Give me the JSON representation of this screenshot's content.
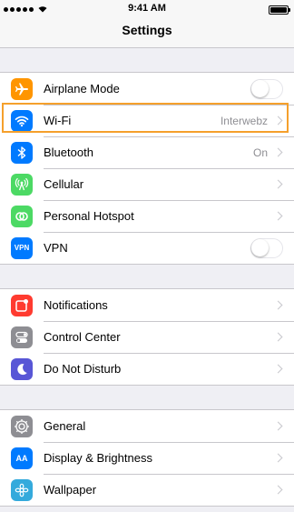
{
  "status_bar": {
    "time": "9:41 AM",
    "signal_icon": "signal-icon",
    "wifi_icon": "wifi-icon",
    "battery_icon": "battery-icon"
  },
  "nav": {
    "title": "Settings"
  },
  "groups": [
    {
      "items": [
        {
          "label": "Airplane Mode",
          "icon": "airplane-icon",
          "color": "#ff9500",
          "accessory": "toggle",
          "toggle_on": false
        },
        {
          "label": "Wi-Fi",
          "icon": "wifi-icon",
          "color": "#007aff",
          "accessory": "chevron",
          "value": "Interwebz",
          "highlighted": true
        },
        {
          "label": "Bluetooth",
          "icon": "bluetooth-icon",
          "color": "#007aff",
          "accessory": "chevron",
          "value": "On"
        },
        {
          "label": "Cellular",
          "icon": "cellular-icon",
          "color": "#4cd964",
          "accessory": "chevron"
        },
        {
          "label": "Personal Hotspot",
          "icon": "hotspot-icon",
          "color": "#4cd964",
          "accessory": "chevron"
        },
        {
          "label": "VPN",
          "icon": "vpn-icon",
          "icon_text": "VPN",
          "color": "#007aff",
          "accessory": "toggle",
          "toggle_on": false
        }
      ]
    },
    {
      "items": [
        {
          "label": "Notifications",
          "icon": "notifications-icon",
          "color": "#ff3b30",
          "accessory": "chevron"
        },
        {
          "label": "Control Center",
          "icon": "control-center-icon",
          "color": "#8e8e93",
          "accessory": "chevron"
        },
        {
          "label": "Do Not Disturb",
          "icon": "moon-icon",
          "color": "#5856d6",
          "accessory": "chevron"
        }
      ]
    },
    {
      "items": [
        {
          "label": "General",
          "icon": "gear-icon",
          "color": "#8e8e93",
          "accessory": "chevron"
        },
        {
          "label": "Display & Brightness",
          "icon": "display-icon",
          "icon_text": "AA",
          "color": "#007aff",
          "accessory": "chevron"
        },
        {
          "label": "Wallpaper",
          "icon": "wallpaper-icon",
          "color": "#34aadc",
          "accessory": "chevron"
        }
      ]
    }
  ],
  "colors": {
    "highlight": "#f5a02c",
    "background": "#efeff4"
  }
}
